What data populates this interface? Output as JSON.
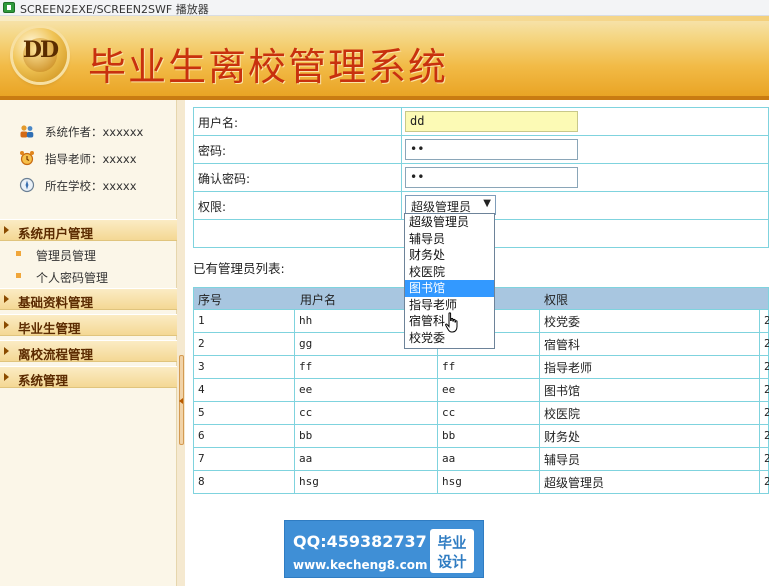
{
  "window": {
    "title": "SCREEN2EXE/SCREEN2SWF 播放器"
  },
  "header": {
    "logo_text": "DD",
    "title": "毕业生离校管理系统"
  },
  "sidebar": {
    "info": [
      {
        "label": "系统作者：xxxxxx",
        "icon": "users-icon"
      },
      {
        "label": "指导老师：xxxxx",
        "icon": "alarm-clock-icon"
      },
      {
        "label": "所在学校：xxxxx",
        "icon": "compass-icon"
      }
    ],
    "sections": [
      {
        "label": "系统用户管理",
        "items": [
          "管理员管理",
          "个人密码管理"
        ]
      },
      {
        "label": "基础资料管理"
      },
      {
        "label": "毕业生管理"
      },
      {
        "label": "离校流程管理"
      },
      {
        "label": "系统管理"
      }
    ]
  },
  "form": {
    "username_label": "用户名:",
    "username_value": "dd",
    "password_label": "密码:",
    "password_value": "••",
    "confirm_label": "确认密码:",
    "confirm_value": "••",
    "role_label": "权限:",
    "role_selected": "超级管理员",
    "role_options": [
      "超级管理员",
      "辅导员",
      "财务处",
      "校医院",
      "图书馆",
      "指导老师",
      "宿管科",
      "校党委"
    ],
    "role_highlighted": "图书馆"
  },
  "list": {
    "caption": "已有管理员列表:",
    "headers": [
      "序号",
      "用户名",
      "",
      "权限",
      ""
    ],
    "rows": [
      [
        "1",
        "hh",
        "",
        "校党委",
        "2"
      ],
      [
        "2",
        "gg",
        "gg",
        "宿管科",
        "2"
      ],
      [
        "3",
        "ff",
        "ff",
        "指导老师",
        "2"
      ],
      [
        "4",
        "ee",
        "ee",
        "图书馆",
        "2"
      ],
      [
        "5",
        "cc",
        "cc",
        "校医院",
        "2"
      ],
      [
        "6",
        "bb",
        "bb",
        "财务处",
        "2"
      ],
      [
        "7",
        "aa",
        "aa",
        "辅导员",
        "2"
      ],
      [
        "8",
        "hsg",
        "hsg",
        "超级管理员",
        "2"
      ]
    ]
  },
  "watermark": {
    "qq": "QQ:459382737",
    "url": "www.kecheng8.com",
    "badge_line1": "毕业",
    "badge_line2": "设计"
  },
  "colors": {
    "header_title": "#c8310e",
    "accent": "#f2bb47",
    "grid_border": "#7fd3de",
    "table_header": "#a8c6e0",
    "highlight": "#3399ff"
  }
}
